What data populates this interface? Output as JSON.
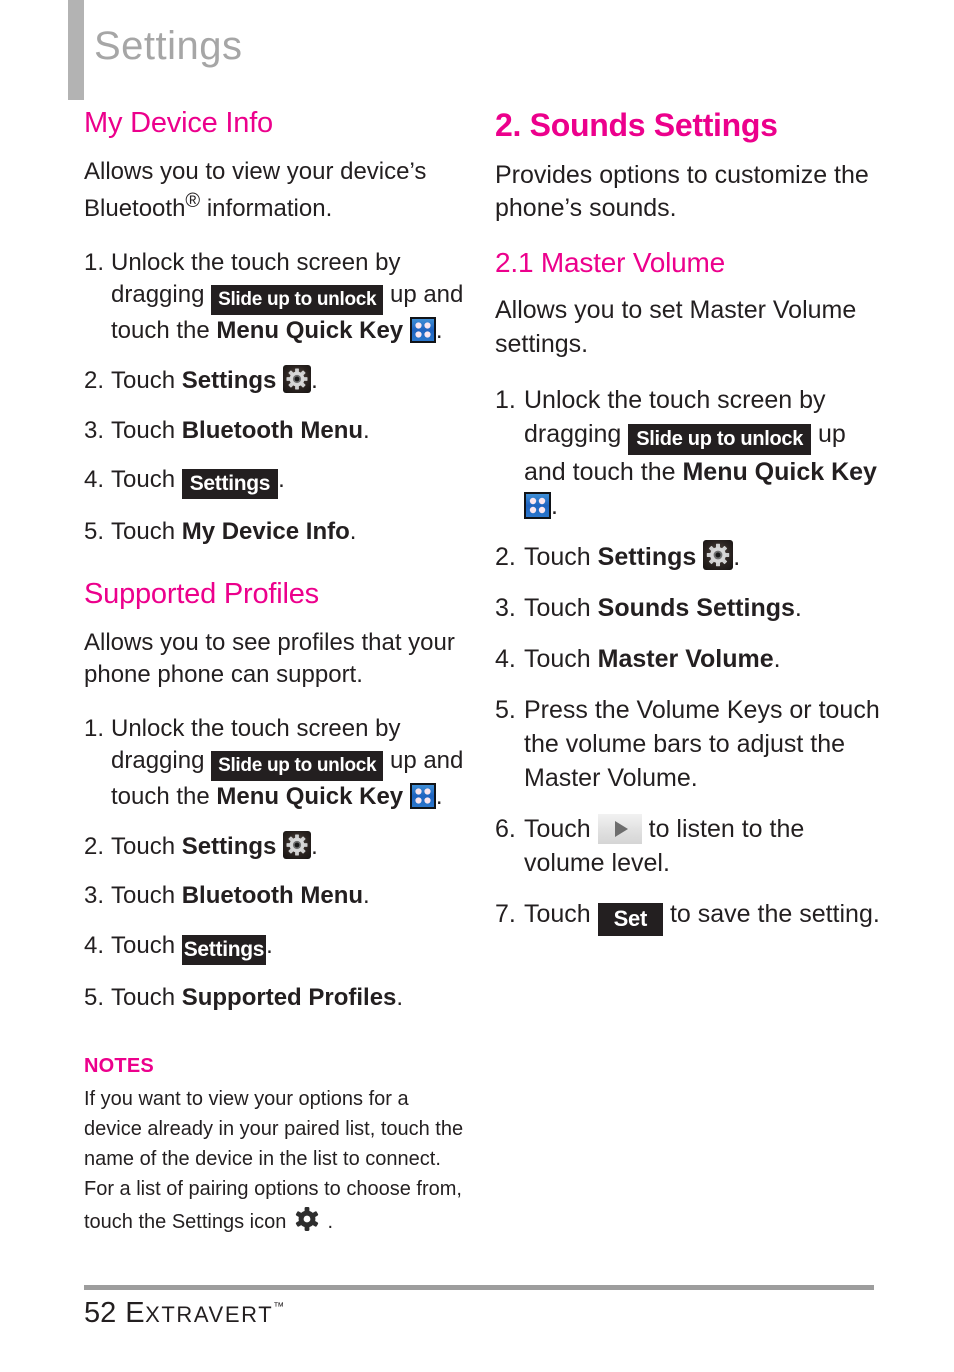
{
  "header": {
    "title": "Settings",
    "accent_gray": "#b3b3b3"
  },
  "colors": {
    "accent_magenta": "#ec008c",
    "badge_dark": "#231f20",
    "header_gray": "#a6a6a6",
    "rule_gray": "#9d9d9d"
  },
  "left_column": {
    "section1": {
      "heading": "My Device Info",
      "intro_line1": "Allows you to view your device’s",
      "intro_line2_a": "Bluetooth",
      "intro_line2_reg": "®",
      "intro_line2_b": " information.",
      "steps": [
        {
          "num": "1.",
          "t1": "Unlock the touch screen by dragging ",
          "badge": "Slide up to unlock",
          "t2": " up and touch the ",
          "bold": "Menu Quick Key",
          "icon": "menu-quick-key-icon",
          "t3": "."
        },
        {
          "num": "2.",
          "t1": "Touch ",
          "bold": "Settings",
          "icon": "settings-gear-icon",
          "t3": "."
        },
        {
          "num": "3.",
          "t1": "Touch ",
          "bold": "Bluetooth Menu",
          "t3": "."
        },
        {
          "num": "4.",
          "t1": "Touch ",
          "badge": "Settings",
          "t3": "."
        },
        {
          "num": "5.",
          "t1": "Touch ",
          "bold": "My Device Info",
          "t3": "."
        }
      ]
    },
    "section2": {
      "heading": "Supported Profiles",
      "intro_line1": "Allows you to see profiles that your",
      "intro_line2": "phone phone can support.",
      "steps": [
        {
          "num": "1.",
          "t1": "Unlock the touch screen by dragging ",
          "badge": "Slide up to unlock",
          "t2": " up and touch the ",
          "bold": "Menu Quick Key",
          "icon": "menu-quick-key-icon",
          "t3": "."
        },
        {
          "num": "2.",
          "t1": "Touch ",
          "bold": "Settings",
          "icon": "settings-gear-icon",
          "t3": "."
        },
        {
          "num": "3.",
          "t1": "Touch ",
          "bold": "Bluetooth Menu",
          "t3": "."
        },
        {
          "num": "4.",
          "t1": "Touch ",
          "badge": "Settings",
          "t3": "."
        },
        {
          "num": "5.",
          "t1": "Touch ",
          "bold": "Supported Profiles",
          "t3": "."
        }
      ]
    },
    "notes": {
      "title": "NOTES",
      "body_a": "If you want to view your options for a device already in your paired list, touch the name of the device in the list to connect. For a list of pairing options to choose from, touch the Settings icon ",
      "icon": "settings-gear-plain-icon",
      "body_b": " ."
    }
  },
  "right_column": {
    "heading_major": "2. Sounds Settings",
    "intro_line1": "Provides options to customize the",
    "intro_line2": "phone’s sounds.",
    "heading_sub": "2.1 Master Volume",
    "sub_intro_line1": "Allows you to set Master Volume",
    "sub_intro_line2": "settings.",
    "steps": [
      {
        "num": "1.",
        "t1": "Unlock the touch screen by dragging ",
        "badge": "Slide up to unlock",
        "t2": " up and touch the ",
        "bold": "Menu Quick Key",
        "icon": "menu-quick-key-icon",
        "t3": "."
      },
      {
        "num": "2.",
        "t1": "Touch ",
        "bold": "Settings",
        "icon": "settings-gear-icon",
        "t3": "."
      },
      {
        "num": "3.",
        "t1": "Touch ",
        "bold": "Sounds Settings",
        "t3": "."
      },
      {
        "num": "4.",
        "t1": "Touch ",
        "bold": "Master Volume",
        "t3": "."
      },
      {
        "num": "5.",
        "t1": "Press the Volume Keys or touch the volume bars to adjust the Master Volume.",
        "t3": ""
      },
      {
        "num": "6.",
        "t1": "Touch ",
        "icon": "play-button-icon",
        "t2": " to listen to the volume level.",
        "t3": ""
      },
      {
        "num": "7.",
        "t1": "Touch ",
        "badge": "Set",
        "t2": " to save the setting.",
        "t3": ""
      }
    ]
  },
  "footer": {
    "page_number": "52",
    "brand_first": "E",
    "brand_rest": "XTRAVERT",
    "trademark": "™"
  }
}
